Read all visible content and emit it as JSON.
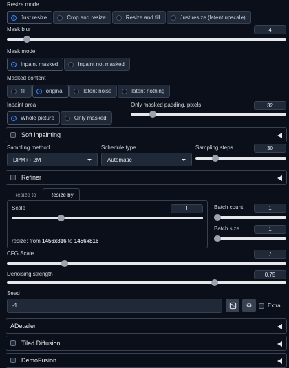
{
  "resize_mode": {
    "label": "Resize mode",
    "options": [
      "Just resize",
      "Crop and resize",
      "Resize and fill",
      "Just resize (latent upscale)"
    ],
    "selected": "Just resize"
  },
  "mask_blur": {
    "label": "Mask blur",
    "value": "4",
    "fraction": 0.06
  },
  "mask_mode": {
    "label": "Mask mode",
    "options": [
      "Inpaint masked",
      "Inpaint not masked"
    ],
    "selected": "Inpaint masked"
  },
  "masked_content": {
    "label": "Masked content",
    "options": [
      "fill",
      "original",
      "latent noise",
      "latent nothing"
    ],
    "selected": "original"
  },
  "inpaint_area": {
    "label": "Inpaint area",
    "options": [
      "Whole picture",
      "Only masked"
    ],
    "selected": "Whole picture"
  },
  "only_masked_padding": {
    "label": "Only masked padding, pixels",
    "value": "32",
    "fraction": 0.125
  },
  "soft_inpainting": {
    "label": "Soft inpainting"
  },
  "sampling_method": {
    "label": "Sampling method",
    "value": "DPM++ 2M"
  },
  "schedule_type": {
    "label": "Schedule type",
    "value": "Automatic"
  },
  "sampling_steps": {
    "label": "Sampling steps",
    "value": "30",
    "fraction": 0.2
  },
  "refiner": {
    "label": "Refiner"
  },
  "resize_tabs": [
    "Resize to",
    "Resize by"
  ],
  "scale": {
    "label": "Scale",
    "value": "1",
    "fraction": 0.25
  },
  "resize_info": {
    "prefix": "resize: from ",
    "from": "1456x816",
    "mid": " to ",
    "to": "1456x816"
  },
  "batch_count": {
    "label": "Batch count",
    "value": "1",
    "fraction": 0.0
  },
  "batch_size": {
    "label": "Batch size",
    "value": "1",
    "fraction": 0.0
  },
  "cfg_scale": {
    "label": "CFG Scale",
    "value": "7",
    "fraction": 0.2
  },
  "denoising_strength": {
    "label": "Denoising strength",
    "value": "0.75",
    "fraction": 0.75
  },
  "seed": {
    "label": "Seed",
    "value": "-1",
    "extra_label": "Extra"
  },
  "accordions": [
    "ADetailer",
    "Tiled Diffusion",
    "DemoFusion"
  ],
  "icons": {
    "dice": "dice-icon",
    "recycle": "recycle-icon"
  },
  "colors": {
    "accent": "#2563eb",
    "background": "#0b0f19",
    "border": "#374151"
  }
}
